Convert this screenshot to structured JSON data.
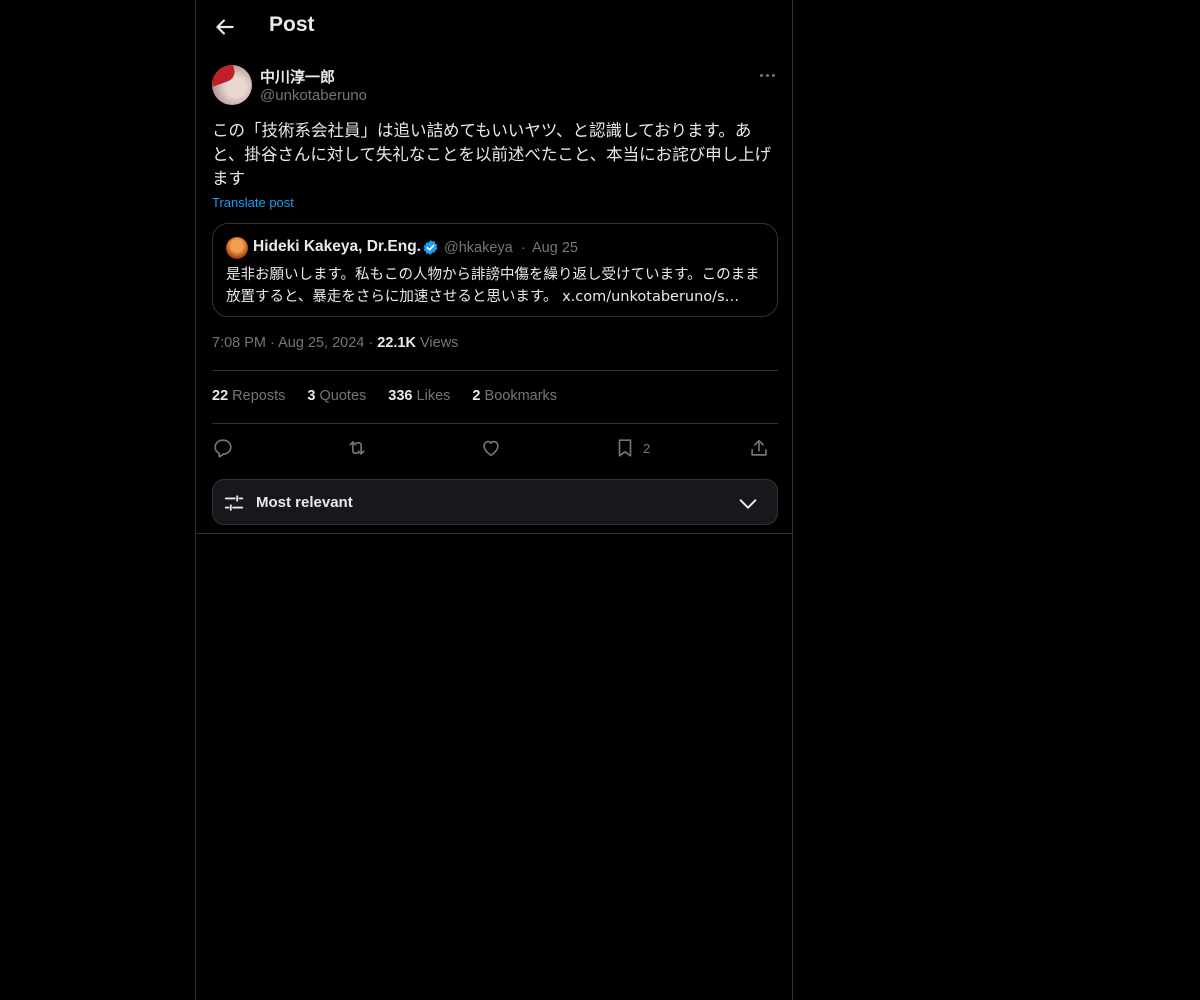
{
  "header": {
    "title": "Post"
  },
  "post": {
    "author_name": "中川淳一郎",
    "author_handle": "@unkotaberuno",
    "text": "この「技術系会社員」は追い詰めてもいいヤツ、と認識しております。あと、掛谷さんに対して失礼なことを以前述べたこと、本当にお詫び申し上げます",
    "translate_label": "Translate post",
    "time": "7:08 PM",
    "date": "Aug 25, 2024",
    "views_count": "22.1K",
    "views_label": "Views"
  },
  "quote": {
    "author_name": "Hideki Kakeya, Dr.Eng.",
    "author_handle": "@hkakeya",
    "date": "Aug 25",
    "text": "是非お願いします。私もこの人物から誹謗中傷を繰り返し受けています。このまま放置すると、暴走をさらに加速させると思います。",
    "link": "x.com/unkotaberuno/s…",
    "verified_color": "#1d9bf0"
  },
  "stats": {
    "reposts_count": "22",
    "reposts_label": "Reposts",
    "quotes_count": "3",
    "quotes_label": "Quotes",
    "likes_count": "336",
    "likes_label": "Likes",
    "bookmarks_count": "2",
    "bookmarks_label": "Bookmarks"
  },
  "actions": {
    "icons": [
      "reply-icon",
      "repost-icon",
      "like-icon",
      "bookmark-icon",
      "share-icon"
    ],
    "bookmark_count": "2"
  },
  "sort": {
    "label": "Most relevant"
  },
  "colors": {
    "background": "#000000",
    "text": "#e7e9ea",
    "muted": "#71767b",
    "accent": "#1d9bf0",
    "border": "#2f3336"
  }
}
